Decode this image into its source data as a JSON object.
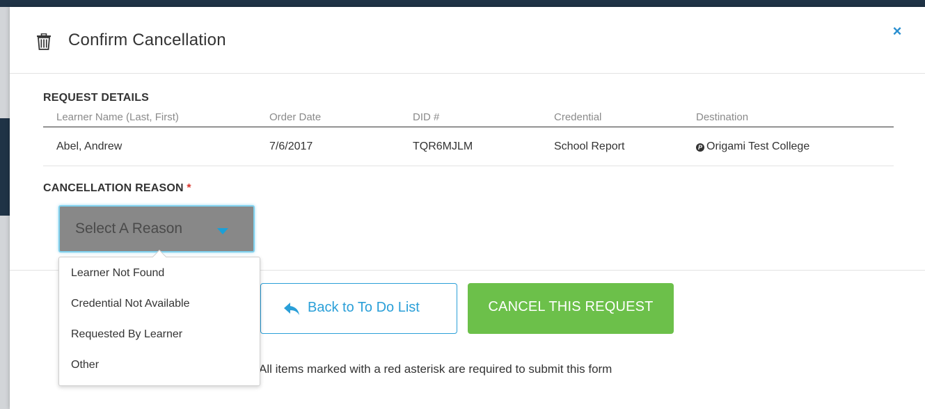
{
  "modal": {
    "title": "Confirm Cancellation",
    "close_glyph": "×"
  },
  "request_details": {
    "heading": "REQUEST DETAILS",
    "columns": [
      "Learner Name (Last, First)",
      "Order Date",
      "DID #",
      "Credential",
      "Destination"
    ],
    "row": {
      "learner_name": "Abel, Andrew",
      "order_date": "7/6/2017",
      "did": "TQR6MJLM",
      "credential": "School Report",
      "destination_icon": "P",
      "destination": "Origami Test College"
    }
  },
  "cancellation_reason": {
    "heading": "CANCELLATION REASON",
    "required_marker": "*",
    "select_placeholder": "Select A Reason",
    "options": [
      "Learner Not Found",
      "Credential Not Available",
      "Requested By Learner",
      "Other"
    ]
  },
  "actions": {
    "back_label": "Back to To Do List",
    "cancel_label": "CANCEL THIS REQUEST"
  },
  "footnote": "All items marked with a red asterisk are required to submit this form",
  "colors": {
    "accent_blue": "#2a9fd8",
    "cancel_green": "#6cc04a",
    "required_red": "#d9342b",
    "select_gray": "#888888"
  }
}
